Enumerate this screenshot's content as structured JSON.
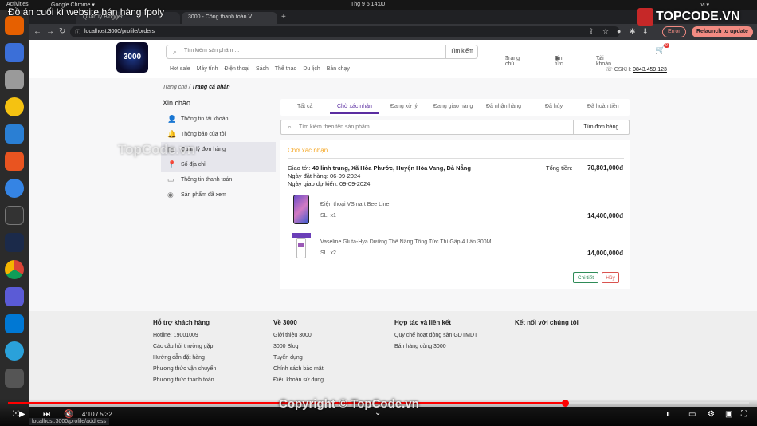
{
  "gnome": {
    "activities": "Activities",
    "app": "Google Chrome ▾",
    "clock": "Thg 9 6  14:00",
    "tray": "vi ▾"
  },
  "chrome": {
    "tab1": "Quản lý Blogger",
    "tab2": "3000 - Cổng thanh toán V",
    "url": "localhost:3000/profile/orders",
    "error": "Error",
    "update": "Relaunch to update"
  },
  "video": {
    "title": "Đồ án cuối kì website bán hàng fpoly",
    "time": "4:10 / 5:32",
    "watermark_center": "Copyright © TopCode.vn",
    "watermark_side": "TopCode.vn",
    "logo": "TOPCODE.VN",
    "status_url": "localhost:3000/profile/address"
  },
  "header": {
    "logo": "3000",
    "search_placeholder": "Tìm kiếm sản phẩm ...",
    "search_button": "Tìm kiếm",
    "home": "Trang chủ",
    "news": "Tin tức",
    "account": "Tài khoản",
    "cart_count": "0",
    "categories": [
      "Hot sale",
      "Máy tính",
      "Điện thoại",
      "Sách",
      "Thể thao",
      "Du lịch",
      "Bán chạy"
    ],
    "hotline_label": "CSKH:",
    "hotline": "0843.459.123"
  },
  "breadcrumb": {
    "home": "Trang chủ",
    "sep": "/",
    "current": "Trang cá nhân"
  },
  "sidebar": {
    "greeting": "Xin chào",
    "items": [
      {
        "label": "Thông tin tài khoản",
        "icon": "user-icon"
      },
      {
        "label": "Thông báo của tôi",
        "icon": "bell-icon"
      },
      {
        "label": "Quản lý đơn hàng",
        "icon": "orders-icon"
      },
      {
        "label": "Số địa chỉ",
        "icon": "location-icon"
      },
      {
        "label": "Thông tin thanh toán",
        "icon": "card-icon"
      },
      {
        "label": "Sản phẩm đã xem",
        "icon": "eye-icon"
      }
    ]
  },
  "order_tabs": [
    "Tất cả",
    "Chờ xác nhận",
    "Đang xử lý",
    "Đang giao hàng",
    "Đã nhận hàng",
    "Đã hủy",
    "Đã hoàn tiền"
  ],
  "order_search": {
    "placeholder": "Tìm kiếm theo tên sản phẩm...",
    "button": "Tìm đơn hàng"
  },
  "order": {
    "status": "Chờ xác nhận",
    "ship_label": "Giao tới:",
    "ship_address": "49 linh trung, Xã Hòa Phước, Huyện Hòa Vang, Đà Nẵng",
    "order_date": "Ngày đặt hàng: 06-09-2024",
    "delivery_date": "Ngày giao dự kiến: 09-09-2024",
    "total_label": "Tổng tiền:",
    "total": "70,801,000đ",
    "items": [
      {
        "name": "Điện thoại VSmart Bee Line",
        "qty": "SL: x1",
        "price": "14,400,000đ"
      },
      {
        "name": "Vaseline Gluta-Hya Dưỡng Thể Nâng Tông Tức Thì Gấp 4 Lần 300ML",
        "qty": "SL: x2",
        "price": "14,000,000đ"
      }
    ],
    "detail_button": "Chi tiết",
    "cancel_button": "Hủy"
  },
  "footer": {
    "cols": [
      {
        "title": "Hỗ trợ khách hàng",
        "items": [
          "Hotline: 19001009",
          "Các câu hỏi thường gặp",
          "Hướng dẫn đặt hàng",
          "Phương thức vận chuyển",
          "Phương thức thanh toán"
        ]
      },
      {
        "title": "Về 3000",
        "items": [
          "Giới thiệu 3000",
          "3000 Blog",
          "Tuyển dụng",
          "Chính sách bảo mật",
          "Điều khoản sử dụng"
        ]
      },
      {
        "title": "Hợp tác và liên kết",
        "items": [
          "Quy chế hoạt động sàn GDTMDT",
          "Bán hàng cùng 3000"
        ]
      },
      {
        "title": "Kết nối với chúng tôi",
        "items": []
      }
    ]
  }
}
